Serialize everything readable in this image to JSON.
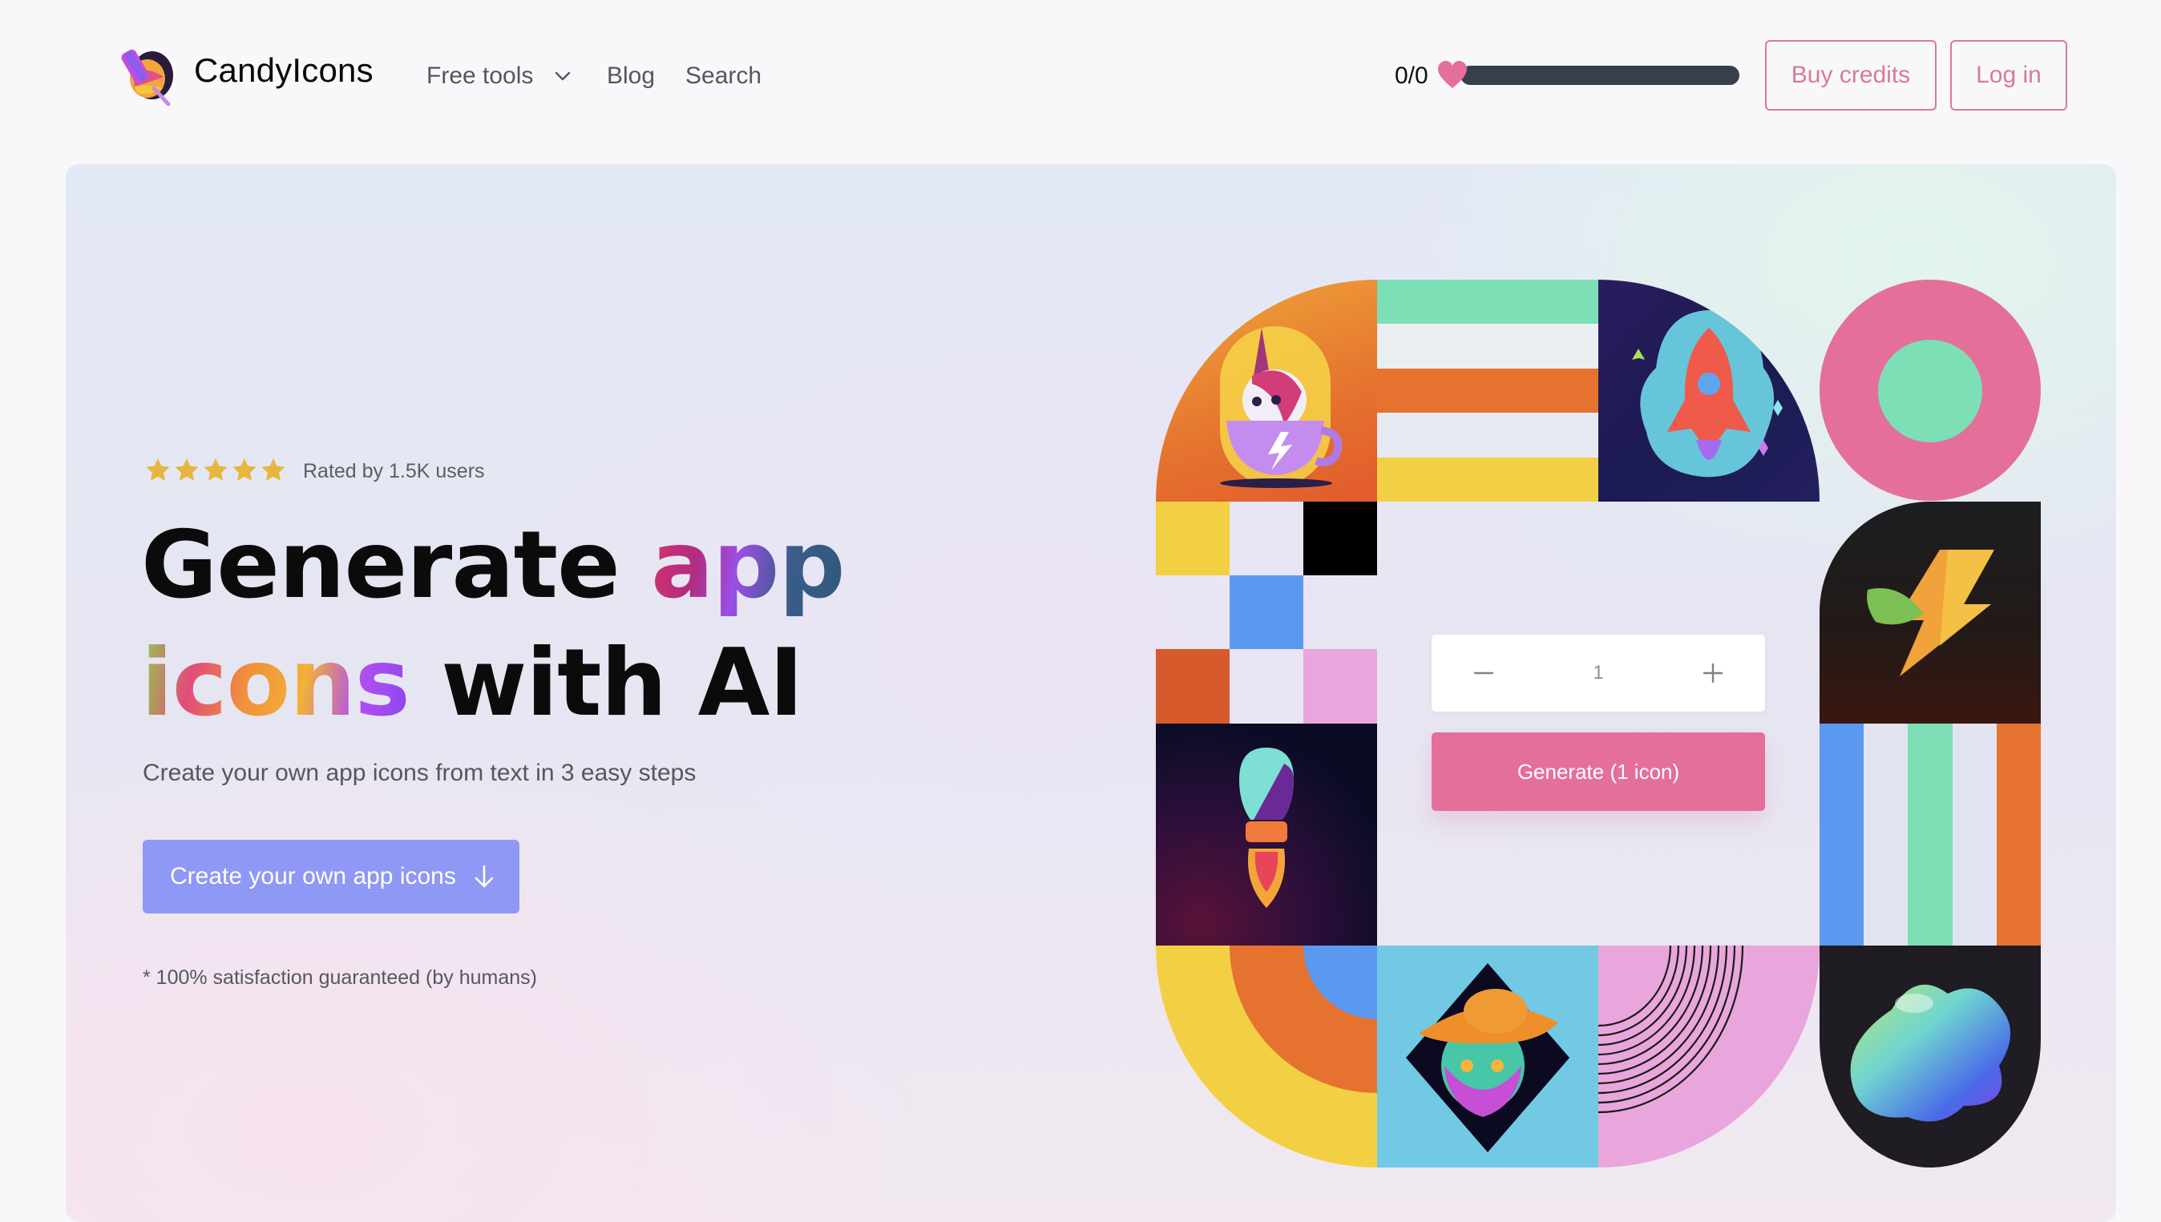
{
  "brand": {
    "name": "CandyIcons",
    "logo_icon": "lollipop-logo-icon"
  },
  "nav": {
    "items": [
      {
        "label": "Free tools",
        "has_dropdown": true
      },
      {
        "label": "Blog"
      },
      {
        "label": "Search"
      }
    ]
  },
  "credits": {
    "text": "0/0",
    "icon": "heart-icon",
    "progress_fraction": 0
  },
  "header_buttons": {
    "buy_credits": "Buy credits",
    "log_in": "Log in"
  },
  "colors": {
    "accent_pink": "#e46f9a",
    "outline_pink": "#d9799b",
    "cta_blue": "#8f98f5",
    "star_gold": "#e7b73d",
    "bar_dark": "#373f4d"
  },
  "hero": {
    "rating": {
      "stars": 5,
      "max_stars": 5,
      "label": "Rated by 1.5K users"
    },
    "title": {
      "line1_plain": "Generate ",
      "line1_gradient": "app",
      "line2_gradient": "icons",
      "line2_plain": " with AI"
    },
    "subtitle": "Create your own app icons from text in 3 easy steps",
    "cta": {
      "label": "Create your own app icons",
      "icon": "arrow-down-icon"
    },
    "footnote": "* 100% satisfaction guaranteed (by humans)"
  },
  "generator": {
    "quantity": "1",
    "decrement_icon": "minus-icon",
    "increment_icon": "plus-icon",
    "generate_label": "Generate (1 icon)"
  },
  "mosaic": {
    "tiles": [
      {
        "name": "unicorn-teacup-icon"
      },
      {
        "name": "horizontal-stripes-pattern",
        "colors": [
          "#7ddfb6",
          "#e9eff0",
          "#e5732f",
          "#e6eaf2",
          "#f3d043"
        ]
      },
      {
        "name": "rocket-bubble-icon"
      },
      {
        "name": "pink-ring-pattern",
        "colors": [
          "#e46f9a",
          "#7ddfb6"
        ]
      },
      {
        "name": "pixel-grid-pattern",
        "colors": [
          "#f3d043",
          "#000000",
          "#5b99f0",
          "#d75a2d",
          "#e8a6dc"
        ]
      },
      {
        "name": "lightning-leaf-icon"
      },
      {
        "name": "rocket-flame-icon"
      },
      {
        "name": "vertical-stripes-pattern",
        "colors": [
          "#5b99f0",
          "#e1e4f0",
          "#7ddfb6",
          "#e1e4f0",
          "#e5732f"
        ]
      },
      {
        "name": "concentric-arcs-pattern",
        "colors": [
          "#f3d043",
          "#e5732f",
          "#5b99f0"
        ]
      },
      {
        "name": "cat-hat-diamond-icon"
      },
      {
        "name": "pink-lines-arc-pattern",
        "colors": [
          "#e8a6dc",
          "#1a1a1a"
        ]
      },
      {
        "name": "liquid-blob-icon"
      }
    ]
  }
}
